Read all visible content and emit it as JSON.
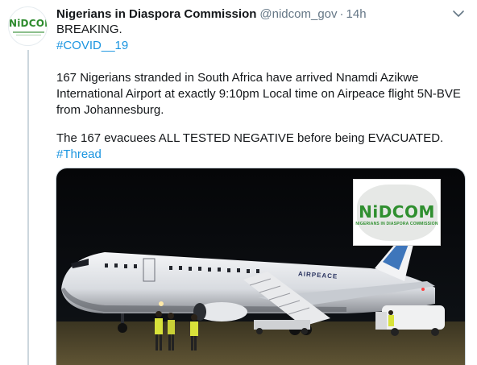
{
  "tweet": {
    "display_name": "Nigerians in Diaspora Commission",
    "handle": "@nidcom_gov",
    "separator": "·",
    "time": "14h",
    "avatar_text": "NiDCOM",
    "lines": {
      "l1": "BREAKING.",
      "l2": "#COVID__19",
      "l3": "167 Nigerians stranded in South Africa have arrived Nnamdi Azikwe",
      "l4": "International Airport at exactly 9:10pm Local time on Airpeace flight 5N-BVE",
      "l5": "from Johannesburg.",
      "l6": "The 167 evacuees ALL TESTED NEGATIVE before being EVACUATED.",
      "l7": "#Thread"
    }
  },
  "media": {
    "badge_title": "NiDCOM",
    "badge_subtitle": "NIGERIANS IN DIASPORA COMMISSION",
    "livery_text": "AIRPEACE"
  },
  "icons": {
    "caret": "chevron-down-icon"
  },
  "colors": {
    "link": "#1b95e0",
    "secondary_text": "#657786",
    "nidcom_green": "#2f8f2f"
  }
}
